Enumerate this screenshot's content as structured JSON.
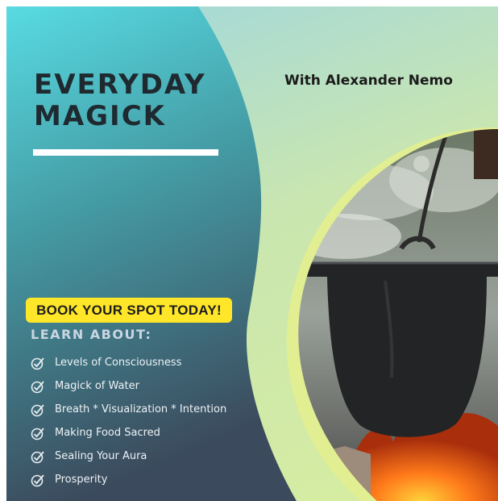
{
  "poster": {
    "title": "EVERYDAY\nMAGICK",
    "host": "With Alexander Nemo",
    "cta_label": "BOOK YOUR SPOT TODAY!",
    "learn_heading": "LEARN ABOUT:",
    "topics": [
      "Levels of Consciousness",
      "Magick of Water",
      "Breath * Visualization * Intention",
      "Making Food Sacred",
      "Sealing Your Aura",
      "Prosperity"
    ],
    "check_icon": "circle-check-icon",
    "photo": "cast-iron-cauldron-over-fire"
  },
  "colors": {
    "panel_top": "#56d3db",
    "panel_bottom": "#3d4e5f",
    "background_light": "#c9e6b0",
    "title": "#1f2a30",
    "cta_yellow": "#ffe628",
    "flame": "#ff7a1a"
  }
}
